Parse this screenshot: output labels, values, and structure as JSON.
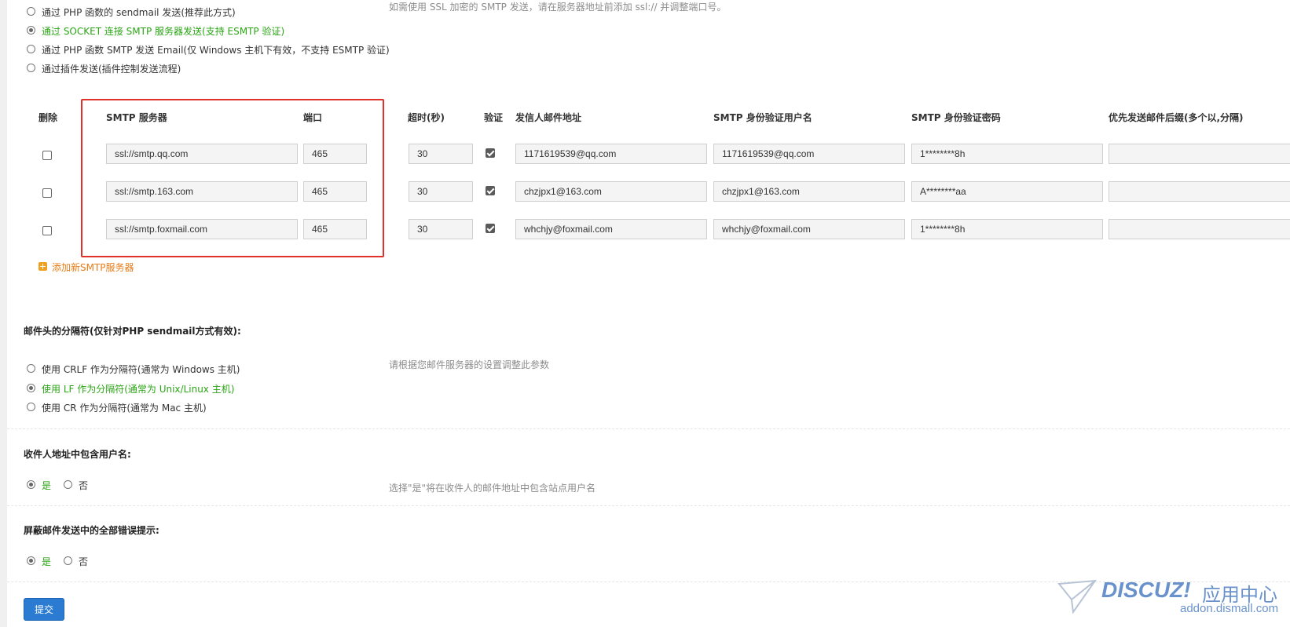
{
  "send_method": {
    "options": [
      {
        "label": "通过 PHP 函数的 sendmail 发送(推荐此方式)",
        "checked": false
      },
      {
        "label": "通过 SOCKET 连接 SMTP 服务器发送(支持 ESMTP 验证)",
        "checked": true
      },
      {
        "label": "通过 PHP 函数 SMTP 发送 Email(仅 Windows 主机下有效，不支持 ESMTP 验证)",
        "checked": false
      },
      {
        "label": "通过插件发送(插件控制发送流程)",
        "checked": false
      }
    ],
    "hint": "如需使用 SSL 加密的 SMTP 发送，请在服务器地址前添加 ssl:// 并调整端口号。"
  },
  "smtp_table": {
    "headers": {
      "delete": "删除",
      "server": "SMTP 服务器",
      "port": "端口",
      "timeout": "超时(秒)",
      "auth": "验证",
      "from": "发信人邮件地址",
      "username": "SMTP 身份验证用户名",
      "password": "SMTP 身份验证密码",
      "suffix": "优先发送邮件后缀(多个以,分隔)"
    },
    "rows": [
      {
        "delete": false,
        "server": "ssl://smtp.qq.com",
        "port": "465",
        "timeout": "30",
        "auth": true,
        "from": "1171619539@qq.com",
        "username": "1171619539@qq.com",
        "password": "1********8h",
        "suffix": ""
      },
      {
        "delete": false,
        "server": "ssl://smtp.163.com",
        "port": "465",
        "timeout": "30",
        "auth": true,
        "from": "chzjpx1@163.com",
        "username": "chzjpx1@163.com",
        "password": "A********aa",
        "suffix": ""
      },
      {
        "delete": false,
        "server": "ssl://smtp.foxmail.com",
        "port": "465",
        "timeout": "30",
        "auth": true,
        "from": "whchjy@foxmail.com",
        "username": "whchjy@foxmail.com",
        "password": "1********8h",
        "suffix": ""
      }
    ],
    "add_label": "添加新SMTP服务器"
  },
  "separator": {
    "title": "邮件头的分隔符(仅针对PHP sendmail方式有效):",
    "options": [
      {
        "label": "使用 CRLF 作为分隔符(通常为 Windows 主机)",
        "checked": false
      },
      {
        "label": "使用 LF 作为分隔符(通常为 Unix/Linux 主机)",
        "checked": true
      },
      {
        "label": "使用 CR 作为分隔符(通常为 Mac 主机)",
        "checked": false
      }
    ],
    "hint": "请根据您邮件服务器的设置调整此参数"
  },
  "include_username": {
    "title": "收件人地址中包含用户名:",
    "yes": "是",
    "no": "否",
    "value": "yes",
    "hint": "选择\"是\"将在收件人的邮件地址中包含站点用户名"
  },
  "silence_errors": {
    "title": "屏蔽邮件发送中的全部错误提示:",
    "yes": "是",
    "no": "否",
    "value": "yes"
  },
  "submit_label": "提交",
  "watermark": {
    "brand": "DISCUZ!",
    "suffix": "应用中心",
    "url": "addon.dismall.com"
  }
}
